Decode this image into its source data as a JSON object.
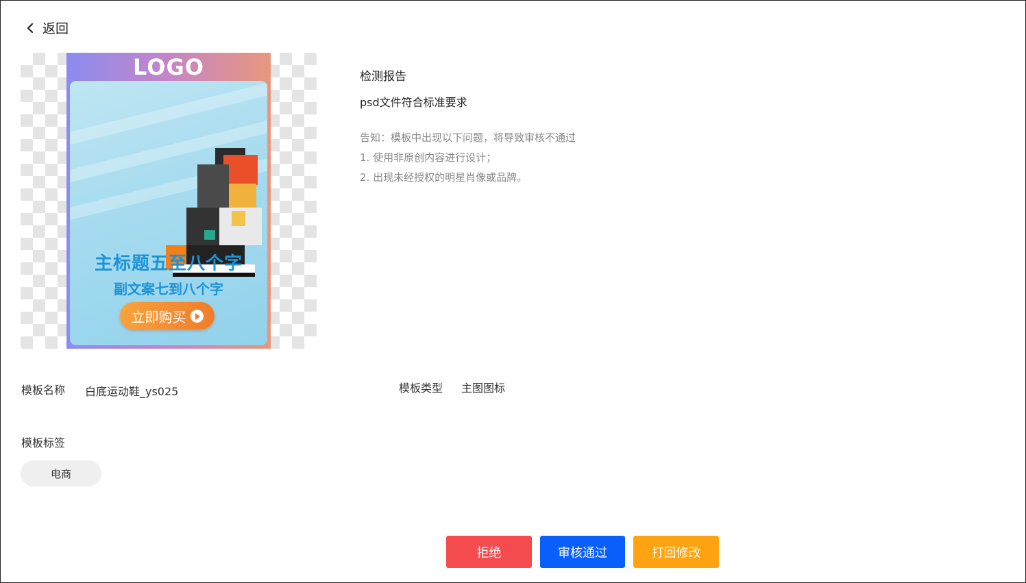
{
  "nav": {
    "back_label": "返回"
  },
  "preview": {
    "logo_text": "LOGO",
    "main_title": "主标题五至八个字",
    "sub_title": "副文案七到八个字",
    "buy_button": "立即购买"
  },
  "report": {
    "title": "检测报告",
    "result": "psd文件符合标准要求",
    "notice": "告知：模板中出现以下问题，将导致审核不通过",
    "rules": [
      "1. 使用非原创内容进行设计；",
      "2. 出现未经授权的明星肖像或品牌。"
    ]
  },
  "template": {
    "name_label": "模板名称",
    "name_value": "白底运动鞋_ys025",
    "type_label": "模板类型",
    "type_value": "主图图标",
    "tags_label": "模板标签",
    "tags": [
      "电商"
    ]
  },
  "actions": {
    "reject": "拒绝",
    "approve": "审核通过",
    "return": "打回修改"
  },
  "colors": {
    "reject": "#f34b4e",
    "approve": "#0a5ffc",
    "return": "#ffa312"
  }
}
